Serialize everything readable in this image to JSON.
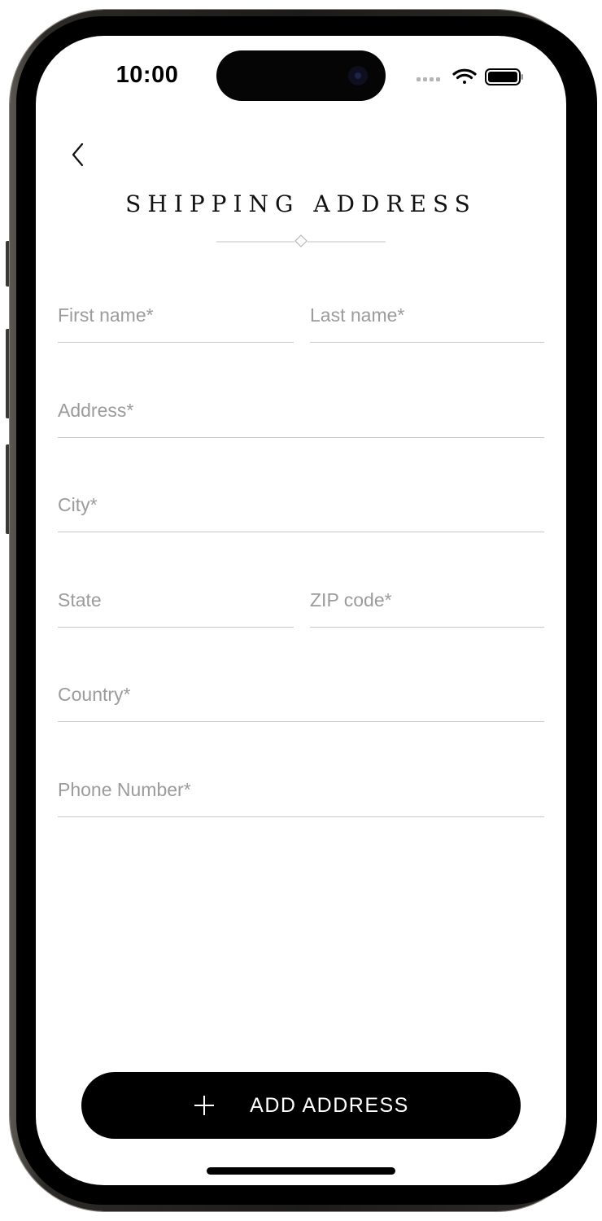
{
  "status_bar": {
    "time": "10:00",
    "icons": [
      "cellular-dots-icon",
      "wifi-icon",
      "battery-icon"
    ]
  },
  "nav": {
    "back_icon": "chevron-left-icon",
    "title": "SHIPPING ADDRESS"
  },
  "form": {
    "first_name": {
      "placeholder": "First name*",
      "value": ""
    },
    "last_name": {
      "placeholder": "Last name*",
      "value": ""
    },
    "address": {
      "placeholder": "Address*",
      "value": ""
    },
    "city": {
      "placeholder": "City*",
      "value": ""
    },
    "state": {
      "placeholder": "State",
      "value": ""
    },
    "zip": {
      "placeholder": "ZIP code*",
      "value": ""
    },
    "country": {
      "placeholder": "Country*",
      "value": ""
    },
    "phone": {
      "placeholder": "Phone Number*",
      "value": ""
    }
  },
  "actions": {
    "add_address_icon": "plus-icon",
    "add_address_label": "ADD ADDRESS"
  },
  "colors": {
    "background": "#ffffff",
    "primary": "#000000",
    "button_text": "#ffffff",
    "placeholder": "#9b9b9b",
    "underline": "#c9c9c9"
  }
}
